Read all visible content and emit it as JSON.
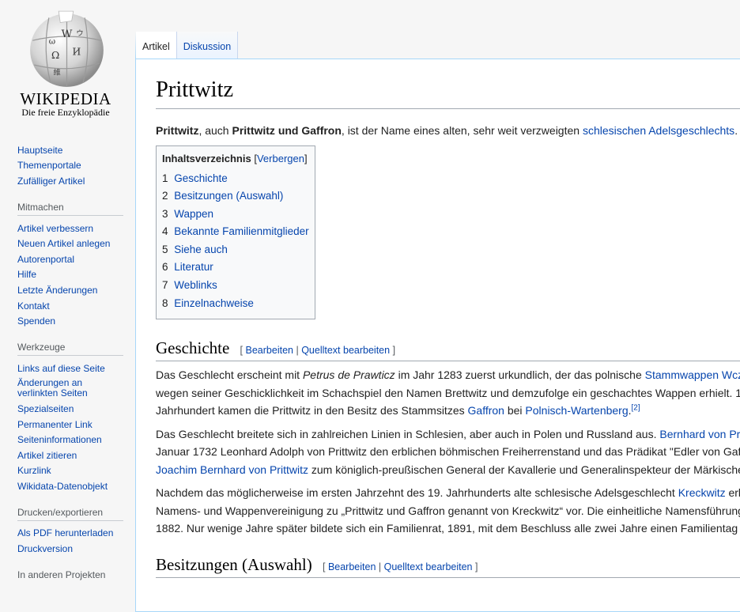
{
  "logo": {
    "wordmark": "WIKIPEDIA",
    "tagline": "Die freie Enzyklopädie"
  },
  "sidebar": {
    "nav": [
      "Hauptseite",
      "Themenportale",
      "Zufälliger Artikel"
    ],
    "mitmachen": {
      "title": "Mitmachen",
      "items": [
        "Artikel verbessern",
        "Neuen Artikel anlegen",
        "Autorenportal",
        "Hilfe",
        "Letzte Änderungen",
        "Kontakt",
        "Spenden"
      ]
    },
    "werkzeuge": {
      "title": "Werkzeuge",
      "items": [
        "Links auf diese Seite",
        "Änderungen an verlinkten Seiten",
        "Spezialseiten",
        "Permanenter Link",
        "Seiteninformationen",
        "Artikel zitieren",
        "Kurzlink",
        "Wikidata-Datenobjekt"
      ]
    },
    "drucken": {
      "title": "Drucken/exportieren",
      "items": [
        "Als PDF herunterladen",
        "Druckversion"
      ]
    },
    "projekte": {
      "title": "In anderen Projekten"
    }
  },
  "tabs": [
    {
      "label": "Artikel",
      "selected": true
    },
    {
      "label": "Diskussion",
      "selected": false
    }
  ],
  "article": {
    "title": "Prittwitz",
    "lead": {
      "b1": "Prittwitz",
      "t1": ", auch ",
      "b2": "Prittwitz und Gaffron",
      "t2": ", ist der Name eines alten, sehr weit verzweigten ",
      "link": "schlesischen Adelsgeschlechts",
      "t3": "."
    },
    "toc": {
      "title": "Inhaltsverzeichnis",
      "toggle": "Verbergen",
      "items": [
        {
          "num": "1",
          "label": "Geschichte"
        },
        {
          "num": "2",
          "label": "Besitzungen (Auswahl)"
        },
        {
          "num": "3",
          "label": "Wappen"
        },
        {
          "num": "4",
          "label": "Bekannte Familienmitglieder"
        },
        {
          "num": "5",
          "label": "Siehe auch"
        },
        {
          "num": "6",
          "label": "Literatur"
        },
        {
          "num": "7",
          "label": "Weblinks"
        },
        {
          "num": "8",
          "label": "Einzelnachweise"
        }
      ]
    },
    "edit_links": {
      "open": "[",
      "edit": "Bearbeiten",
      "sep": "|",
      "source": "Quelltext bearbeiten",
      "close": "]"
    },
    "geschichte": {
      "heading": "Geschichte",
      "p1": {
        "a": "Das Geschlecht erscheint mit ",
        "i": "Petrus de Prawticz",
        "b": " im Jahr 1283 zuerst urkundlich, der das polnische ",
        "link": "Stammwappen Wcz",
        "line2": "wegen seiner Geschicklichkeit im Schachspiel den Namen Brettwitz und demzufolge ein geschachtes Wappen erhielt. 1",
        "line3a": "Jahrhundert kamen die Prittwitz in den Besitz des Stammsitzes ",
        "link2": "Gaffron",
        "line3b": " bei ",
        "link3": "Polnisch-Wartenberg",
        "line3c": ".",
        "ref": "[2]"
      },
      "p2": {
        "a": "Das Geschlecht breitete sich in zahlreichen Linien in Schlesien, aber auch in Polen und Russland aus. ",
        "link": "Bernhard von Pr",
        "line2": "Januar 1732 Leonhard Adolph von Prittwitz den erblichen böhmischen Freiherrenstand und das Prädikat \"Edler von Gaf",
        "link2": "Joachim Bernhard von Prittwitz",
        "line3": " zum königlich-preußischen General der Kavallerie und Generalinspekteur der Märkische"
      },
      "p3": {
        "a": "Nachdem das möglicherweise im ersten Jahrzehnt des 19. Jahrhunderts alte schlesische Adelsgeschlecht ",
        "link": "Kreckwitz",
        "b": " erl",
        "line2": "Namens- und Wappenvereinigung zu „Prittwitz und Gaffron genannt von Kreckwitz“ vor. Die einheitliche Namensführung",
        "line3": "1882. Nur wenige Jahre später bildete sich ein Familienrat, 1891, mit dem Beschluss alle zwei Jahre einen Familientag"
      }
    },
    "besitz": {
      "heading": "Besitzungen (Auswahl)"
    }
  }
}
